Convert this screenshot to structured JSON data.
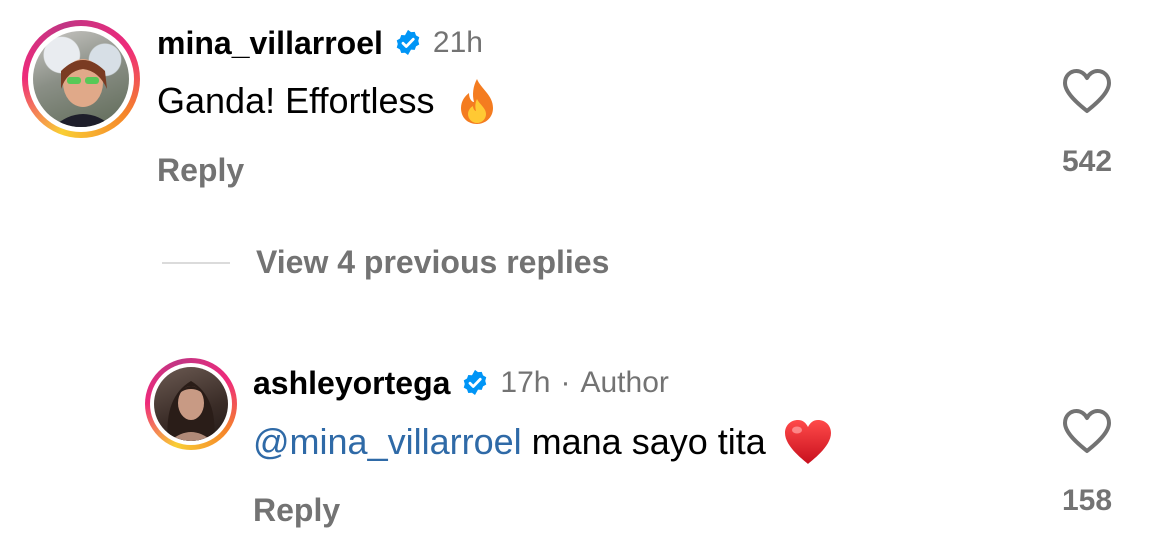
{
  "comments": [
    {
      "username": "mina_villarroel",
      "verified": true,
      "time": "21h",
      "text": "Ganda! Effortless",
      "emoji": "fire-emoji",
      "reply_label": "Reply",
      "likes": "542"
    },
    {
      "username": "ashleyortega",
      "verified": true,
      "time": "17h",
      "separator": "·",
      "author_badge": "Author",
      "mention": "@mina_villarroel",
      "text": " mana sayo tita",
      "emoji": "red-heart-emoji",
      "reply_label": "Reply",
      "likes": "158"
    }
  ],
  "view_replies": "View 4 previous replies",
  "colors": {
    "text": "#000000",
    "secondary": "#737373",
    "mention": "#2f6aa7",
    "verified": "#0095f6",
    "divider": "#dbdbdb"
  },
  "icons": {
    "verified": "verified-badge-icon",
    "like": "heart-outline-icon"
  }
}
